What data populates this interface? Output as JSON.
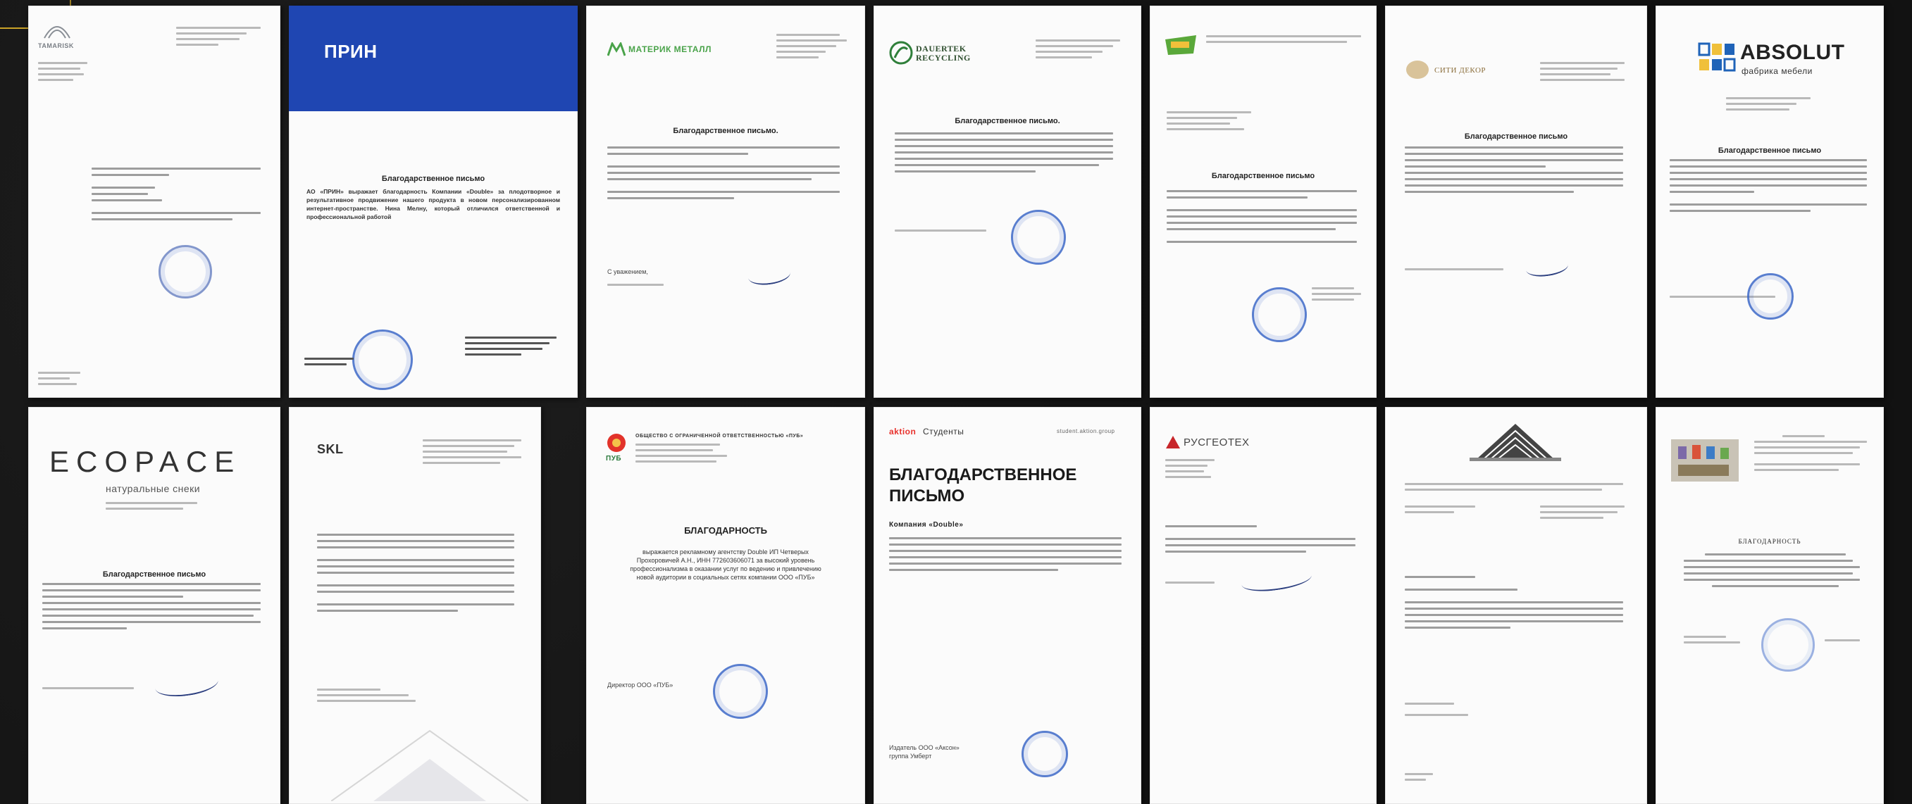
{
  "letters_row1": [
    {
      "id": "tamarisk",
      "logo": "TAMARISK",
      "title": "",
      "sig": ""
    },
    {
      "id": "prin",
      "logo": "ПРИН",
      "title": "Благодарственное письмо",
      "body": "АО «ПРИН» выражает благодарность Компании «Double» за плодотворное и результативное продвижение нашего продукта в новом персонализированном интернет-пространстве. Нина Мелну, который отличился ответственной и профессиональной работой",
      "sig": ""
    },
    {
      "id": "materik",
      "logo": "МАТЕРИК МЕТАЛЛ",
      "title": "Благодарственное письмо.",
      "sig": "С уважением,"
    },
    {
      "id": "dauertek",
      "logo": "DAUERTEK RECYCLING",
      "title": "Благодарственное письмо.",
      "sig": ""
    },
    {
      "id": "green",
      "logo": "",
      "title": "Благодарственное письмо",
      "sig": ""
    },
    {
      "id": "sitidekor",
      "logo": "СИТИ ДЕКОР",
      "title": "Благодарственное письмо",
      "sig": ""
    },
    {
      "id": "absolut",
      "logo": "ABSOLUT",
      "logo_sub": "фабрика мебели",
      "title": "Благодарственное письмо",
      "sig": ""
    }
  ],
  "letters_row2": [
    {
      "id": "ecospace",
      "logo": "ECOPACE",
      "logo_sub": "натуральные снеки",
      "title": "Благодарственное письмо",
      "sig": ""
    },
    {
      "id": "skl",
      "logo": "SKL",
      "title": "",
      "sig": ""
    },
    {
      "id": "pub",
      "logo": "ПУБ",
      "header": "ОБЩЕСТВО С ОГРАНИЧЕННОЙ ОТВЕТСТВЕННОСТЬЮ «ПУБ»",
      "title": "БЛАГОДАРНОСТЬ",
      "body": "выражается рекламному агентству Double ИП Четверых Прохоровичей А.Н., ИНН 772603606071 за высокий уровень профессионализма в оказании услуг по ведению и привлечению новой аудитории в социальных сетях компании ООО «ПУБ»",
      "sig": "Директор ООО «ПУБ»"
    },
    {
      "id": "aktion",
      "logo": "aktion",
      "logo_tail": "Студенты",
      "url": "student.aktion.group",
      "title": "БЛАГОДАРСТВЕННОЕ ПИСЬМО",
      "body_head": "Компания «Double»",
      "sig": "Издатель ООО «Аксон» группа Умберт"
    },
    {
      "id": "rusgeotex",
      "logo": "РУСГЕОТЕХ",
      "title": "",
      "sig": ""
    },
    {
      "id": "stripes",
      "logo": "",
      "title": "",
      "sig": ""
    },
    {
      "id": "spb",
      "logo": "",
      "title": "БЛАГОДАРНОСТЬ",
      "sig": ""
    }
  ],
  "colors": {
    "background": "#141414",
    "paper": "#fbfbfb",
    "prin_blue": "#1f46b2",
    "stamp_blue": "#3d69c8",
    "materik_green": "#4aa34a",
    "aktion_red": "#e8322d",
    "absolut_blue": "#1f63b8",
    "geotex_red": "#c8262b"
  }
}
